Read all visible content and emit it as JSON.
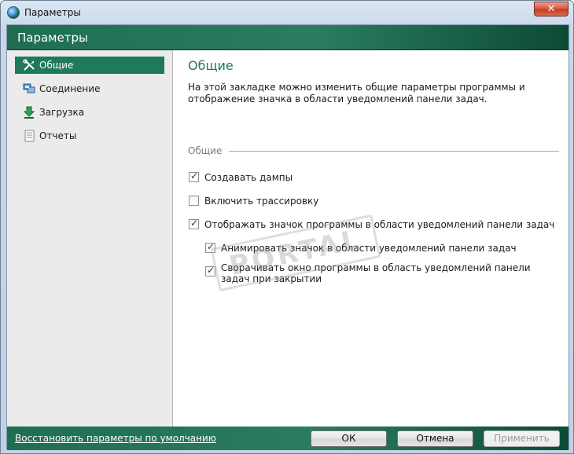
{
  "window": {
    "title": "Параметры",
    "close_label": "✕"
  },
  "header": {
    "title": "Параметры"
  },
  "sidebar": {
    "items": [
      {
        "label": "Общие",
        "icon": "tools-icon",
        "active": true
      },
      {
        "label": "Соединение",
        "icon": "network-icon",
        "active": false
      },
      {
        "label": "Загрузка",
        "icon": "download-arrow-icon",
        "active": false
      },
      {
        "label": "Отчеты",
        "icon": "report-icon",
        "active": false
      }
    ]
  },
  "main": {
    "title": "Общие",
    "description": "На этой закладке можно изменить общие параметры программы и отображение значка в области уведомлений панели задач.",
    "group_label": "Общие",
    "options": [
      {
        "label": "Создавать дампы",
        "checked": true
      },
      {
        "label": "Включить трассировку",
        "checked": false
      },
      {
        "label": "Отображать значок программы в области уведомлений панели задач",
        "checked": true
      },
      {
        "label": "Анимировать значок в области уведомлений панели задач",
        "checked": true
      },
      {
        "label": "Сворачивать окно программы в область уведомлений панели задач при закрытии",
        "checked": true
      }
    ]
  },
  "watermark": {
    "text": "PORTAL"
  },
  "footer": {
    "reset_link": "Восстановить параметры по умолчанию",
    "ok_label": "ОК",
    "cancel_label": "Отмена",
    "apply_label": "Применить"
  },
  "colors": {
    "accent": "#1f7a5a",
    "header_dark": "#0d4a35",
    "sidebar_bg": "#ebebeb",
    "close_red": "#c23a20"
  }
}
